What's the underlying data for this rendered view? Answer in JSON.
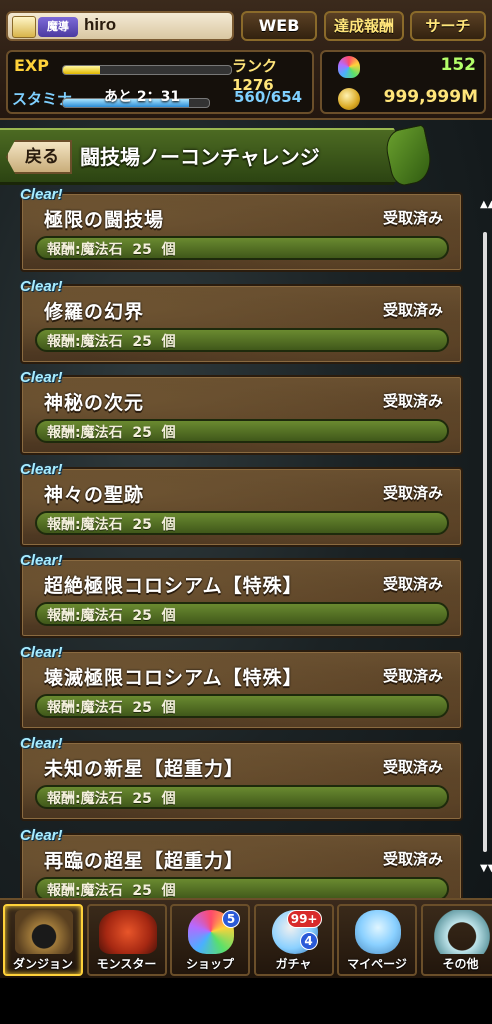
{
  "top": {
    "title_badge": "魔導",
    "player_name": "hiro",
    "web_button": "WEB",
    "achievements_button": "達成報酬",
    "search_button": "サーチ",
    "exp_label": "EXP",
    "rank": "ランク1276",
    "exp_progress": 0.22,
    "stamina_label": "スタミナ",
    "stamina_timer": "あと 2：31",
    "stamina_value": "560/654",
    "stamina_progress": 0.86,
    "magic_stones": "152",
    "coins": "999,999M"
  },
  "header": {
    "back_label": "戻る",
    "title": "闘技場ノーコンチャレンジ"
  },
  "quests": [
    {
      "clear": "Clear!",
      "title": "極限の闘技場",
      "status": "受取済み",
      "reward": "報酬:魔法石  25  個"
    },
    {
      "clear": "Clear!",
      "title": "修羅の幻界",
      "status": "受取済み",
      "reward": "報酬:魔法石  25  個"
    },
    {
      "clear": "Clear!",
      "title": "神秘の次元",
      "status": "受取済み",
      "reward": "報酬:魔法石  25  個"
    },
    {
      "clear": "Clear!",
      "title": "神々の聖跡",
      "status": "受取済み",
      "reward": "報酬:魔法石  25  個"
    },
    {
      "clear": "Clear!",
      "title": "超絶極限コロシアム【特殊】",
      "status": "受取済み",
      "reward": "報酬:魔法石  25  個"
    },
    {
      "clear": "Clear!",
      "title": "壊滅極限コロシアム【特殊】",
      "status": "受取済み",
      "reward": "報酬:魔法石  25  個"
    },
    {
      "clear": "Clear!",
      "title": "未知の新星【超重力】",
      "status": "受取済み",
      "reward": "報酬:魔法石  25  個"
    },
    {
      "clear": "Clear!",
      "title": "再臨の超星【超重力】",
      "status": "受取済み",
      "reward": "報酬:魔法石  25  個"
    }
  ],
  "scroll": {
    "up": "▲▲",
    "down": "▼▼"
  },
  "nav": [
    {
      "label": "ダンジョン",
      "icon": "dungeon-gate-icon"
    },
    {
      "label": "モンスター",
      "icon": "dragon-monster-icon"
    },
    {
      "label": "ショップ",
      "icon": "magic-stone-icon",
      "badge": "5",
      "badge_color": "#2a5ad8"
    },
    {
      "label": "ガチャ",
      "icon": "egg-gacha-icon",
      "badge": "99+",
      "badge_color": "#d82a2a",
      "badge2": "4",
      "badge2_color": "#2a5ad8"
    },
    {
      "label": "マイページ",
      "icon": "character-icon"
    },
    {
      "label": "その他",
      "icon": "horseshoe-icon"
    }
  ]
}
